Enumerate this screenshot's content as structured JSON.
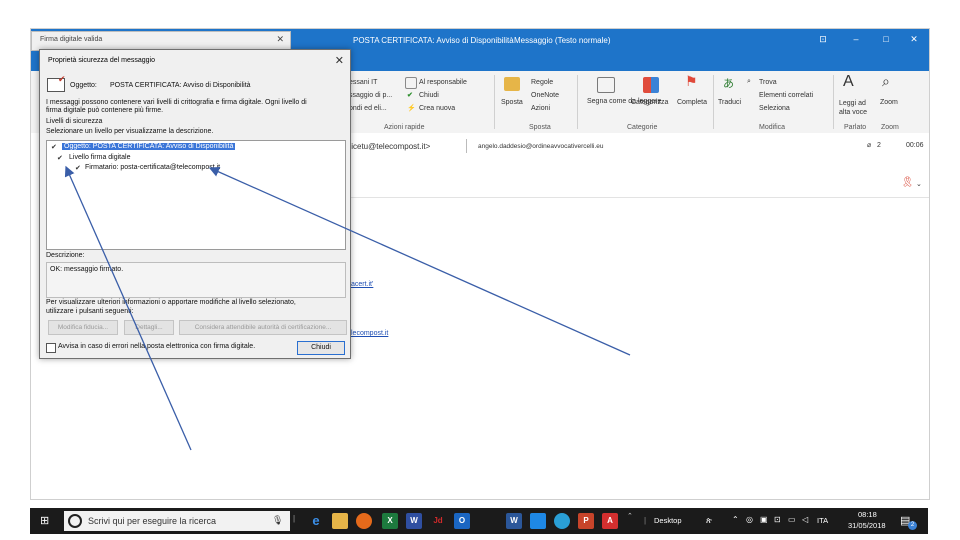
{
  "outlook": {
    "title": "POSTA CERTIFICATA: Avviso di Disponibilità",
    "subtitle": "Messaggio (Testo normale)",
    "window_controls": [
      "⊡",
      "–",
      "□",
      "✕"
    ],
    "ribbon": {
      "quick_steps": [
        "Al responsabile",
        "Chiudi",
        "Crea nuova"
      ],
      "left_cut": [
        "essani IT",
        "ssaggio di p...",
        "ondi ed eli..."
      ],
      "move": {
        "label": "Sposta",
        "items": [
          "Regole",
          "OneNote",
          "Azioni"
        ]
      },
      "tags": {
        "read": "Segna come da leggere",
        "categorize": "Categorizza",
        "complete": "Completa"
      },
      "translate": "Traduci",
      "editing": [
        "Trova",
        "Elementi correlati",
        "Seleziona"
      ],
      "speech": "Leggi ad alta voce",
      "zoom": "Zoom",
      "groups": [
        "Azioni rapide",
        "Sposta",
        "Categorie",
        "Modifica",
        "Parlato",
        "Zoom"
      ]
    },
    "header": {
      "from": "alicetu@telecompost.it>",
      "to": "angelo.daddesio@ordineavvocativercelli.eu",
      "attach_count": "2",
      "time": "00:06"
    },
    "body_links": [
      "acert.it'",
      "lecompost.it"
    ]
  },
  "firma_dialog": {
    "title": "Firma digitale valida",
    "close": "✕"
  },
  "dialog": {
    "title": "Proprietà sicurezza del messaggio",
    "close": "✕",
    "subject_label": "Oggetto:",
    "subject": "POSTA CERTIFICATA: Avviso di Disponibilità",
    "intro": [
      "I messaggi possono contenere vari livelli di crittografia e firma digitale. Ogni livello di",
      "firma digitale può contenere più firme."
    ],
    "levels_label": "Livelli di sicurezza",
    "select_label": "Selezionare un livello per visualizzarne la descrizione.",
    "tree": [
      "Oggetto: POSTA CERTIFICATA: Avviso di Disponibilità",
      "Livello firma digitale",
      "Firmatario: posta-certificata@telecompost.it"
    ],
    "description_label": "Descrizione:",
    "description": "OK: messaggio firmato.",
    "more_info": [
      "Per visualizzare ulteriori informazioni o apportare modifiche al livello selezionato,",
      "utilizzare i pulsanti seguenti:"
    ],
    "buttons": {
      "edit_trust": "Modifica fiducia...",
      "details": "Dettagli...",
      "trust_ca": "Considera attendibile autorità di certificazione..."
    },
    "warn_checkbox": "Avvisa in caso di errori nella posta elettronica con firma digitale.",
    "close_button": "Chiudi"
  },
  "taskbar": {
    "search_placeholder": "Scrivi qui per eseguire la ricerca",
    "desktop": "Desktop",
    "lang": "ITA",
    "time": "08:18",
    "date": "31/05/2018",
    "notif_count": "2",
    "apps": [
      "e",
      "",
      "",
      "X",
      "W",
      "Jd",
      "O",
      "",
      "W",
      "",
      "",
      "P",
      "A"
    ]
  },
  "colors": {
    "titlebar": "#1e74c9",
    "taskbar": "#1b1b1b",
    "selection": "#3a75d8",
    "arrow": "#3a5ea8"
  }
}
